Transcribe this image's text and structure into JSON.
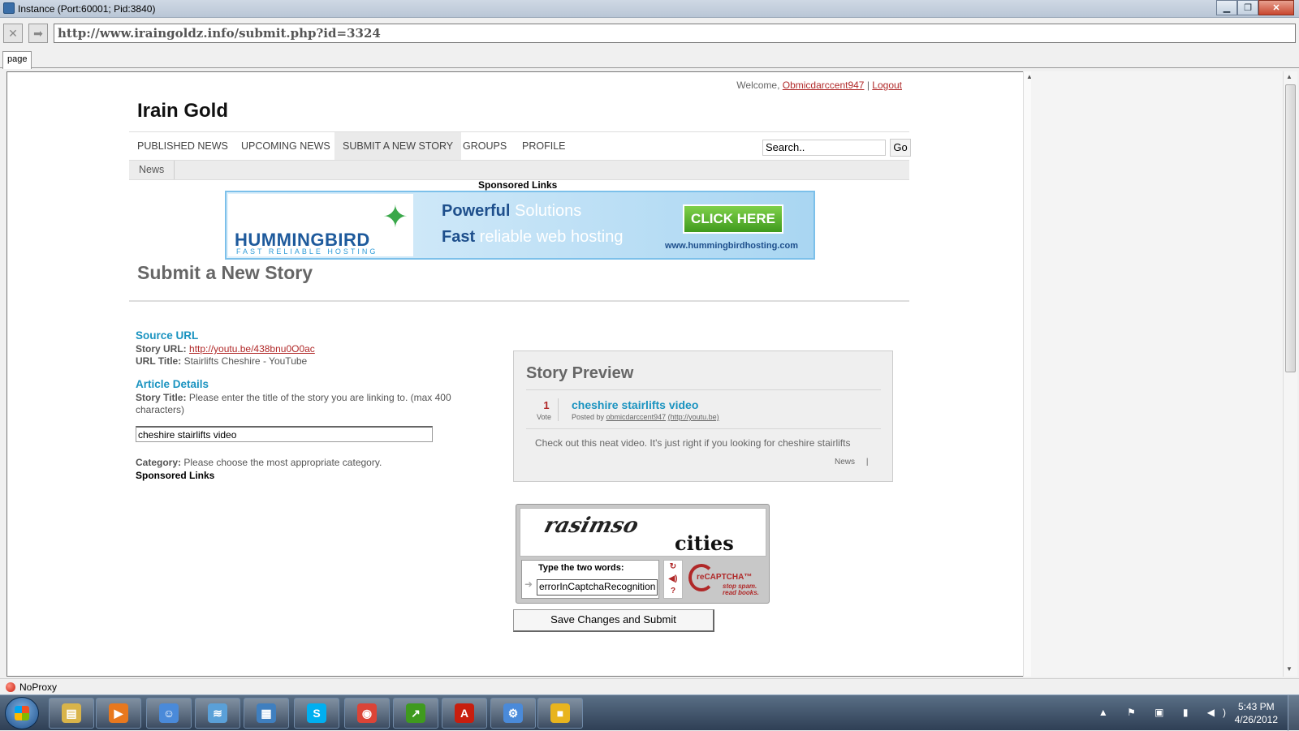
{
  "window": {
    "title": "Instance (Port:60001; Pid:3840)",
    "minimize_glyph": "▁",
    "restore_glyph": "❐",
    "close_glyph": "✕"
  },
  "browser": {
    "url": "http://www.iraingoldz.info/submit.php?id=3324",
    "tab_label": "page",
    "stop_glyph": "✕",
    "go_glyph": "➡",
    "status_text": "NoProxy"
  },
  "site": {
    "welcome_prefix": "Welcome,",
    "username": "Obmicdarccent947",
    "separator": "|",
    "logout_label": "Logout",
    "title": "Irain Gold",
    "nav": [
      {
        "label": "PUBLISHED NEWS"
      },
      {
        "label": "UPCOMING NEWS"
      },
      {
        "label": "SUBMIT A NEW STORY",
        "active": true
      },
      {
        "label": "GROUPS"
      },
      {
        "label": "PROFILE"
      }
    ],
    "search_value": "Search..",
    "go_label": "Go",
    "subnav_item": "News",
    "sponsored_links": "Sponsored Links"
  },
  "banner": {
    "logo": "HUMMINGBIRD",
    "logo_sub": "FAST RELIABLE HOSTING",
    "line1_bold": "Powerful",
    "line1_rest": " Solutions",
    "line2_bold": "Fast",
    "line2_rest": " reliable web hosting",
    "cta": "CLICK HERE",
    "site": "www.hummingbirdhosting.com"
  },
  "form": {
    "heading": "Submit a New Story",
    "source_section": "Source URL",
    "story_url_label": "Story URL:",
    "story_url": "http://youtu.be/438bnu0O0ac",
    "url_title_label": "URL Title:",
    "url_title": "Stairlifts Cheshire - YouTube",
    "article_section": "Article Details",
    "story_title_label": "Story Title:",
    "story_title_help": "Please enter the title of the story you are linking to. (max 400",
    "story_title_help2": "characters)",
    "story_title_value": "cheshire stairlifts video",
    "category_label": "Category:",
    "category_help": "Please choose the most appropriate category.",
    "sponsored_links": "Sponsored Links",
    "submit_label": "Save Changes and Submit"
  },
  "preview": {
    "title": "Story Preview",
    "votes": "1",
    "vote_label": "Vote",
    "story_title": "cheshire stairlifts video",
    "posted_by_prefix": "Posted by",
    "posted_by": "obmicdarccent947",
    "posted_source": "(http://youtu.be)",
    "description": "Check out this neat video. It's just right if you looking for cheshire stairlifts",
    "category": "News",
    "category_sep": "|"
  },
  "captcha": {
    "word1": "rasimso",
    "word2": "cities",
    "prompt": "Type the two words:",
    "answer": "errorInCaptchaRecognition",
    "refresh_glyph": "↻",
    "audio_glyph": "◀)",
    "help_glyph": "?",
    "brand": "reCAPTCHA™",
    "tagline1": "stop spam.",
    "tagline2": "read books."
  },
  "taskbar": {
    "apps": [
      {
        "icon": "explorer-icon",
        "glyph": "▤",
        "color": "#d9b44a"
      },
      {
        "icon": "media-player-icon",
        "glyph": "▶",
        "color": "#e8781e"
      },
      {
        "icon": "people-icon",
        "glyph": "☺",
        "color": "#4a8ad9"
      },
      {
        "icon": "network-icon",
        "glyph": "≋",
        "color": "#5aa0d8"
      },
      {
        "icon": "control-panel-icon",
        "glyph": "▦",
        "color": "#3f7fbf"
      },
      {
        "icon": "skype-icon",
        "glyph": "S",
        "color": "#00aff0"
      },
      {
        "icon": "chrome-icon",
        "glyph": "◉",
        "color": "#db4437"
      },
      {
        "icon": "chart-app-icon",
        "glyph": "↗",
        "color": "#3f9a1e"
      },
      {
        "icon": "acrobat-icon",
        "glyph": "A",
        "color": "#c81e0e"
      },
      {
        "icon": "network-tool-icon",
        "glyph": "⚙",
        "color": "#4a8ad9"
      },
      {
        "icon": "tiles-icon",
        "glyph": "■",
        "color": "#e8b41e"
      }
    ],
    "tray": "▲ ⚑ ▣ ▮ ◀)",
    "time": "5:43 PM",
    "date": "4/26/2012"
  }
}
